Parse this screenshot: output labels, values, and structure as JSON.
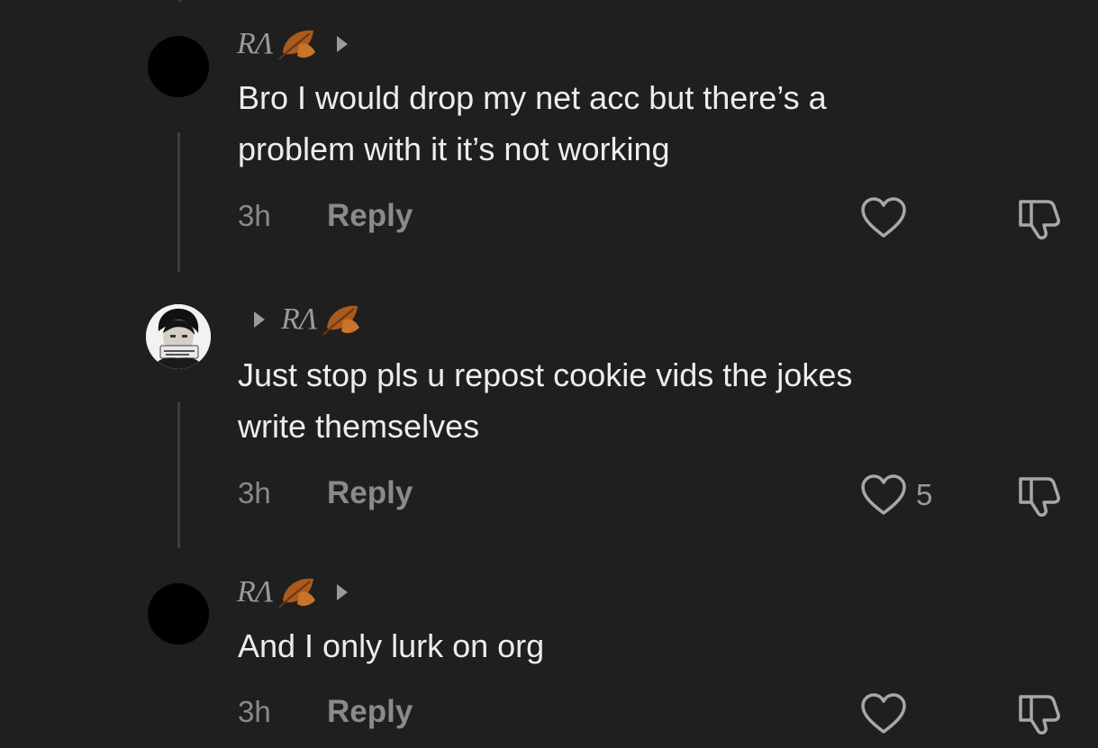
{
  "comments": [
    {
      "username": "RΛ",
      "leaf_icon": "fallen-leaf-emoji",
      "text_line1": "Bro I would drop my net acc but there’s a",
      "text_line2": "problem with it it’s not working",
      "time": "3h",
      "reply_label": "Reply",
      "likes": ""
    },
    {
      "username": "RΛ",
      "leaf_icon": "fallen-leaf-emoji",
      "text_line1": "Just stop pls u repost cookie vids the jokes",
      "text_line2": "write themselves",
      "time": "3h",
      "reply_label": "Reply",
      "likes": "5"
    },
    {
      "username": "RΛ",
      "leaf_icon": "fallen-leaf-emoji",
      "text_line1": "And I only lurk on org",
      "time": "3h",
      "reply_label": "Reply",
      "likes": ""
    }
  ],
  "colors": {
    "background": "#1f1f1f",
    "text": "#ededed",
    "muted": "#8a8a8a",
    "leaf": "#b5651d"
  }
}
